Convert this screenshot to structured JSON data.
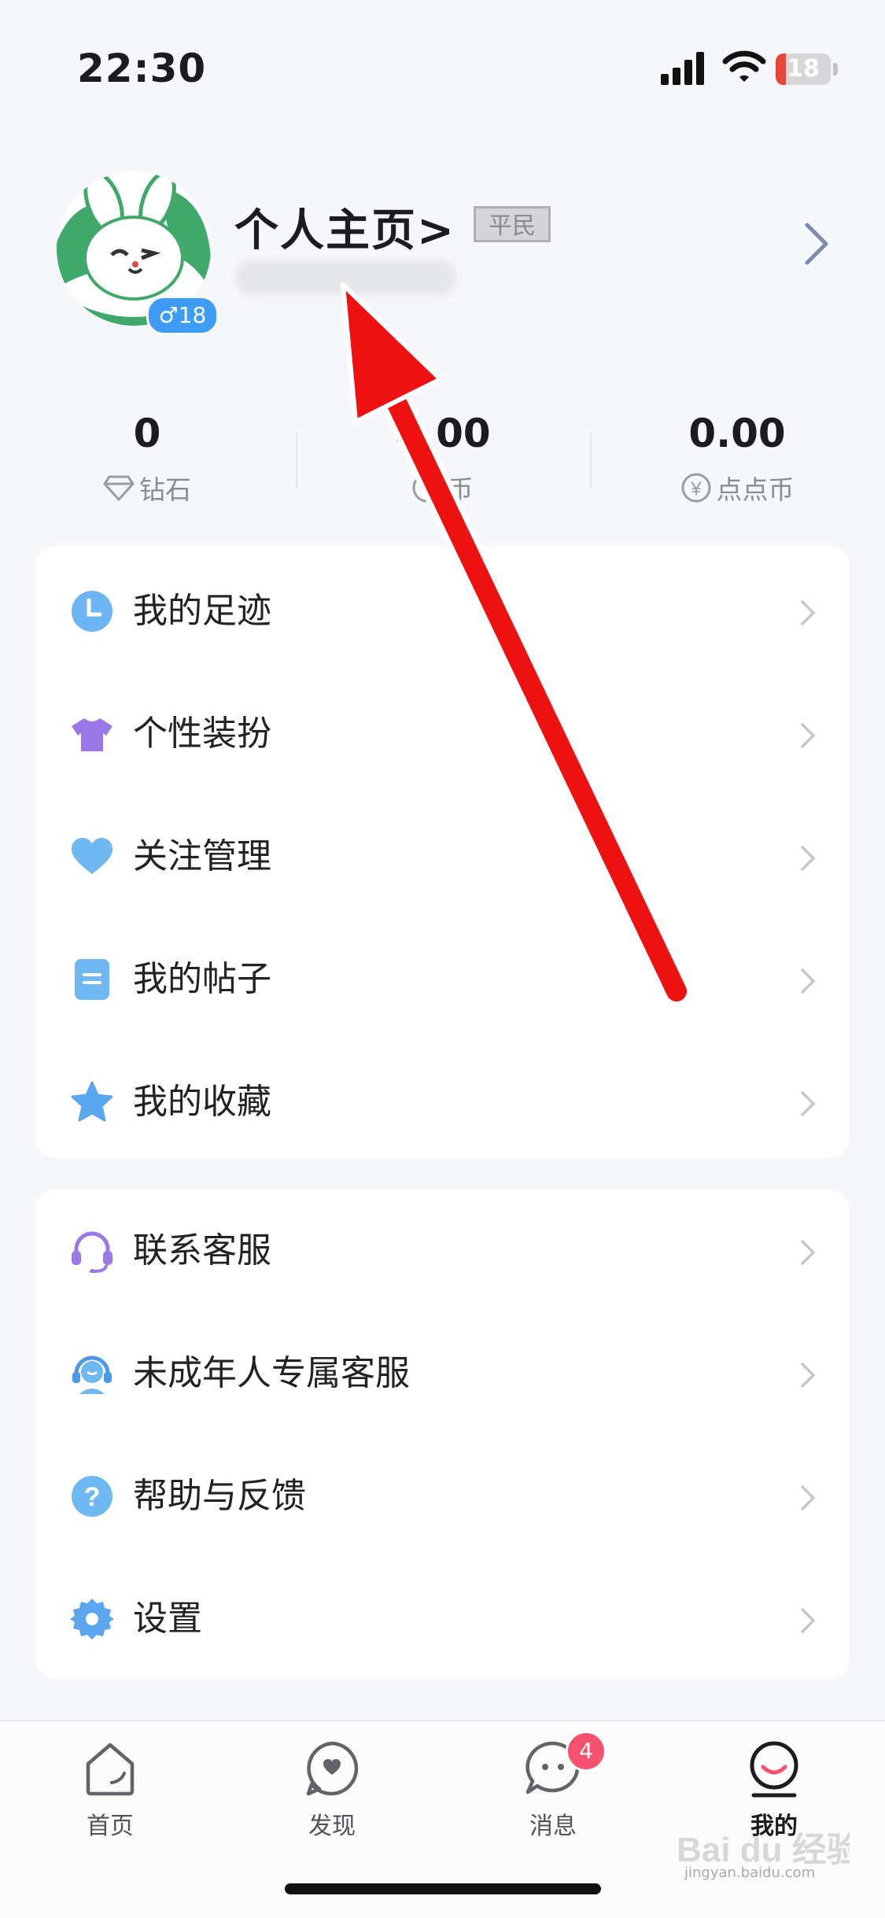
{
  "status_bar": {
    "time": "22:30",
    "battery": "18",
    "battery_level": 0.18,
    "battery_color": "#e5473d"
  },
  "profile": {
    "title": "个人主页>",
    "level_badge": "平民",
    "gender_badge": "♂18",
    "avatar_icon": "rabbit-avatar"
  },
  "stats": [
    {
      "value": "0",
      "label": "钻石",
      "icon": "diamond-icon"
    },
    {
      "value": "0.00",
      "label": "币",
      "icon": "dollar-icon"
    },
    {
      "value": "0.00",
      "label": "点点币",
      "icon": "yen-icon"
    }
  ],
  "menu_group_1": [
    {
      "label": "我的足迹",
      "icon": "clock-icon"
    },
    {
      "label": "个性装扮",
      "icon": "tshirt-icon"
    },
    {
      "label": "关注管理",
      "icon": "heart-icon"
    },
    {
      "label": "我的帖子",
      "icon": "document-icon"
    },
    {
      "label": "我的收藏",
      "icon": "star-icon"
    }
  ],
  "menu_group_2": [
    {
      "label": "联系客服",
      "icon": "headset-icon"
    },
    {
      "label": "未成年人专属客服",
      "icon": "support-agent-icon"
    },
    {
      "label": "帮助与反馈",
      "icon": "help-icon"
    },
    {
      "label": "设置",
      "icon": "gear-icon"
    }
  ],
  "tab_bar": {
    "tabs": [
      {
        "label": "首页",
        "icon": "home-icon"
      },
      {
        "label": "发现",
        "icon": "discover-icon"
      },
      {
        "label": "消息",
        "icon": "message-icon",
        "badge": "4"
      },
      {
        "label": "我的",
        "icon": "profile-icon",
        "active": true
      }
    ]
  },
  "colors": {
    "accent_blue": "#3f9cf6",
    "badge_pink": "#f5506d",
    "annotation_red": "#ee1111"
  },
  "watermark": {
    "brand": "Bai du 经验",
    "url": "jingyan.baidu.com"
  }
}
